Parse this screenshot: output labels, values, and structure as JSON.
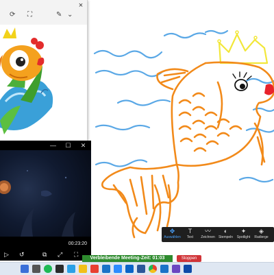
{
  "photo_viewer": {
    "toolbar": {
      "rotate_icon": "rotate-icon",
      "crop_icon": "crop-icon",
      "edit_icon": "edit-icon",
      "close_glyph": "×"
    }
  },
  "video_player": {
    "window_controls": {
      "minimize": "—",
      "maximize": "☐",
      "close": "✕"
    },
    "time": "00:23:20",
    "controls": [
      "play-icon",
      "skip-icon",
      "loop-icon",
      "fullscreen-icon",
      "volume-icon"
    ]
  },
  "zoom_toolbar": {
    "tools": [
      {
        "icon": "✥",
        "label": "Auswählen",
        "active": true
      },
      {
        "icon": "T",
        "label": "Text"
      },
      {
        "icon": "〰",
        "label": "Zeichnen"
      },
      {
        "icon": "◐",
        "label": "Stempeln"
      },
      {
        "icon": "✦",
        "label": "Spotlight"
      },
      {
        "icon": "◈",
        "label": "Radierge"
      }
    ]
  },
  "meeting": {
    "timer_label": "Verbleibende Meeting-Zeit: 01:03",
    "stop_label": "Stoppen"
  },
  "taskbar": {
    "apps": [
      "app-icon-1",
      "app-icon-2",
      "spotify-icon",
      "app-icon-3",
      "app-icon-4",
      "chrome-icon",
      "video-icon",
      "outlook-icon",
      "word-icon",
      "terminal-icon",
      "player-icon",
      "app-icon-5",
      "app-icon-6"
    ]
  },
  "colors": {
    "drawing_orange": "#f28a1a",
    "drawing_blue": "#5aa8e6",
    "drawing_red": "#e8222b",
    "drawing_yellow": "#f2e73a",
    "timer_green": "#2e8b2e",
    "stop_red": "#d13438"
  }
}
